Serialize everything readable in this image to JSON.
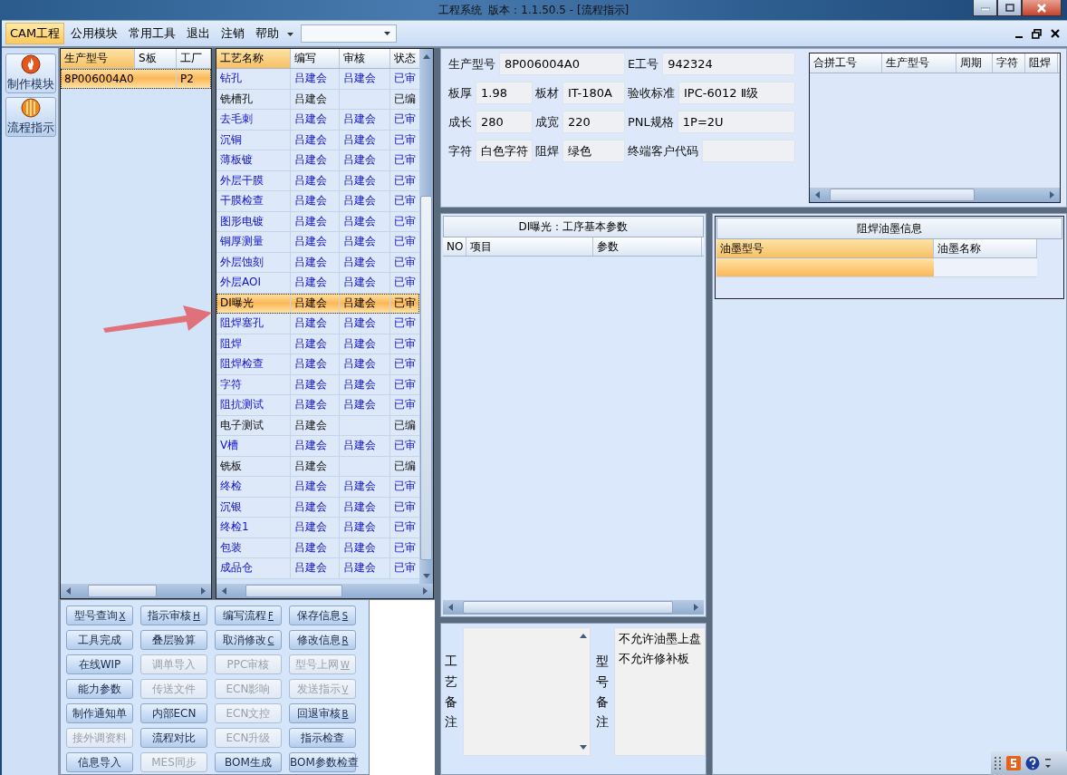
{
  "window": {
    "title": "工程系统  版本：1.1.50.5 - [流程指示]"
  },
  "menu": [
    {
      "label": "CAM工程",
      "selected": true
    },
    {
      "label": "公用模块",
      "selected": false
    },
    {
      "label": "常用工具",
      "selected": false
    },
    {
      "label": "退出",
      "selected": false
    },
    {
      "label": "注销",
      "selected": false
    },
    {
      "label": "帮助",
      "selected": false
    }
  ],
  "nav": [
    {
      "label": "制作模块",
      "kind": "flame",
      "selected": false
    },
    {
      "label": "流程指示",
      "kind": "ball",
      "selected": true
    }
  ],
  "product_grid": {
    "columns": [
      "生产型号",
      "S板",
      "工厂"
    ],
    "rows": [
      {
        "model": "8P006004A0",
        "factory": "P2",
        "selected": true
      }
    ]
  },
  "process_grid": {
    "columns": [
      "工艺名称",
      "编写",
      "审核",
      "状态"
    ],
    "rows": [
      {
        "name": "钻孔",
        "writer": "吕建会",
        "reviewer": "吕建会",
        "status": "已审",
        "approved": true,
        "selected": false
      },
      {
        "name": "铣槽孔",
        "writer": "吕建会",
        "status": "已编",
        "approved": false,
        "selected": false
      },
      {
        "name": "去毛刺",
        "writer": "吕建会",
        "reviewer": "吕建会",
        "status": "已审",
        "approved": true,
        "selected": false
      },
      {
        "name": "沉铜",
        "writer": "吕建会",
        "reviewer": "吕建会",
        "status": "已审",
        "approved": true,
        "selected": false
      },
      {
        "name": "薄板镀",
        "writer": "吕建会",
        "reviewer": "吕建会",
        "status": "已审",
        "approved": true,
        "selected": false
      },
      {
        "name": "外层干膜",
        "writer": "吕建会",
        "reviewer": "吕建会",
        "status": "已审",
        "approved": true,
        "selected": false
      },
      {
        "name": "干膜检查",
        "writer": "吕建会",
        "reviewer": "吕建会",
        "status": "已审",
        "approved": true,
        "selected": false
      },
      {
        "name": "图形电镀",
        "writer": "吕建会",
        "reviewer": "吕建会",
        "status": "已审",
        "approved": true,
        "selected": false
      },
      {
        "name": "铜厚测量",
        "writer": "吕建会",
        "reviewer": "吕建会",
        "status": "已审",
        "approved": true,
        "selected": false
      },
      {
        "name": "外层蚀刻",
        "writer": "吕建会",
        "reviewer": "吕建会",
        "status": "已审",
        "approved": true,
        "selected": false
      },
      {
        "name": "外层AOI",
        "writer": "吕建会",
        "reviewer": "吕建会",
        "status": "已审",
        "approved": true,
        "selected": false
      },
      {
        "name": "DI曝光",
        "writer": "吕建会",
        "reviewer": "吕建会",
        "status": "已审",
        "approved": true,
        "selected": true
      },
      {
        "name": "阻焊塞孔",
        "writer": "吕建会",
        "reviewer": "吕建会",
        "status": "已审",
        "approved": true,
        "selected": false
      },
      {
        "name": "阻焊",
        "writer": "吕建会",
        "reviewer": "吕建会",
        "status": "已审",
        "approved": true,
        "selected": false
      },
      {
        "name": "阻焊检查",
        "writer": "吕建会",
        "reviewer": "吕建会",
        "status": "已审",
        "approved": true,
        "selected": false
      },
      {
        "name": "字符",
        "writer": "吕建会",
        "reviewer": "吕建会",
        "status": "已审",
        "approved": true,
        "selected": false
      },
      {
        "name": "阻抗测试",
        "writer": "吕建会",
        "reviewer": "吕建会",
        "status": "已审",
        "approved": true,
        "selected": false
      },
      {
        "name": "电子测试",
        "writer": "吕建会",
        "status": "已编",
        "approved": false,
        "selected": false
      },
      {
        "name": "V槽",
        "writer": "吕建会",
        "reviewer": "吕建会",
        "status": "已审",
        "approved": true,
        "selected": false
      },
      {
        "name": "铣板",
        "writer": "吕建会",
        "status": "已编",
        "approved": false,
        "selected": false
      },
      {
        "name": "终检",
        "writer": "吕建会",
        "reviewer": "吕建会",
        "status": "已审",
        "approved": true,
        "selected": false
      },
      {
        "name": "沉银",
        "writer": "吕建会",
        "reviewer": "吕建会",
        "status": "已审",
        "approved": true,
        "selected": false
      },
      {
        "name": "终检1",
        "writer": "吕建会",
        "reviewer": "吕建会",
        "status": "已审",
        "approved": true,
        "selected": false
      },
      {
        "name": "包装",
        "writer": "吕建会",
        "reviewer": "吕建会",
        "status": "已审",
        "approved": true,
        "selected": false
      },
      {
        "name": "成品仓",
        "writer": "吕建会",
        "reviewer": "吕建会",
        "status": "已审",
        "approved": true,
        "selected": false
      }
    ]
  },
  "actions": [
    {
      "label": "型号查询",
      "key": "X",
      "disabled": false
    },
    {
      "label": "指示审核",
      "key": "H",
      "disabled": false
    },
    {
      "label": "编写流程",
      "key": "F",
      "disabled": false
    },
    {
      "label": "保存信息",
      "key": "S",
      "disabled": false
    },
    {
      "label": "工具完成",
      "disabled": false
    },
    {
      "label": "叠层验算",
      "disabled": false
    },
    {
      "label": "取消修改",
      "key": "C",
      "disabled": false
    },
    {
      "label": "修改信息",
      "key": "R",
      "disabled": false
    },
    {
      "label": "在线WIP",
      "disabled": false
    },
    {
      "label": "调单导入",
      "disabled": true
    },
    {
      "label": "PPC审核",
      "disabled": true
    },
    {
      "label": "型号上网",
      "key": "W",
      "disabled": true
    },
    {
      "label": "能力参数",
      "disabled": false
    },
    {
      "label": "传送文件",
      "disabled": true
    },
    {
      "label": "ECN影响",
      "disabled": true
    },
    {
      "label": "发送指示",
      "key": "V",
      "disabled": true
    },
    {
      "label": "制作通知单",
      "disabled": false
    },
    {
      "label": "内部ECN",
      "disabled": false
    },
    {
      "label": "ECN文控",
      "disabled": true
    },
    {
      "label": "回退审核",
      "key": "B",
      "disabled": false
    },
    {
      "label": "接外调资料",
      "disabled": true
    },
    {
      "label": "流程对比",
      "disabled": false
    },
    {
      "label": "ECN升级",
      "disabled": true
    },
    {
      "label": "指示检查",
      "disabled": false
    },
    {
      "label": "信息导入",
      "disabled": false
    },
    {
      "label": "MES同步",
      "disabled": true
    },
    {
      "label": "BOM生成",
      "disabled": false
    },
    {
      "label": "BOM参数检查",
      "disabled": false
    }
  ],
  "info": {
    "fields": [
      {
        "label": "生产型号",
        "value": "8P006004A0"
      },
      {
        "label": "E工号",
        "value": "942324"
      },
      {
        "label": "板厚",
        "value": "1.98"
      },
      {
        "label": "板材",
        "value": "IT-180A"
      },
      {
        "label": "验收标准",
        "value": "IPC-6012 Ⅱ级"
      },
      {
        "label": "成长",
        "value": "280"
      },
      {
        "label": "成宽",
        "value": "220"
      },
      {
        "label": "PNL规格",
        "value": "1P=2U"
      },
      {
        "label": "字符",
        "value": "白色字符"
      },
      {
        "label": "阻焊",
        "value": "绿色"
      },
      {
        "label": "终端客户代码"
      }
    ],
    "merge_table": {
      "columns": [
        "合拼工号",
        "生产型号",
        "周期",
        "字符",
        "阻焊"
      ]
    }
  },
  "params_panel": {
    "title": "DI曝光：工序基本参数",
    "columns": [
      "NO",
      "项目",
      "参数"
    ]
  },
  "ink_panel": {
    "title": "阻焊油墨信息",
    "columns": [
      "油墨型号",
      "油墨名称"
    ]
  },
  "remarks": [
    {
      "label": "工艺备注"
    },
    {
      "label": "型号备注",
      "lines": [
        "不允许油墨上盘",
        "不允许修补板"
      ]
    }
  ]
}
